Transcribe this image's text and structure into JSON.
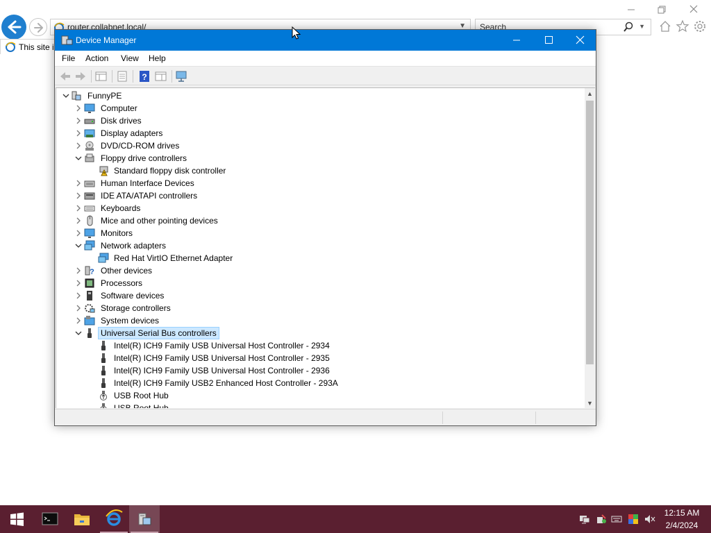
{
  "browser": {
    "address_url": "router.collabnet.local/",
    "search_placeholder": "Search",
    "tab_title": "This site is"
  },
  "device_manager": {
    "title": "Device Manager",
    "menu": [
      "File",
      "Action",
      "View",
      "Help"
    ],
    "tree": [
      {
        "label": "FunnyPE",
        "level": 0,
        "expander": "expanded",
        "icon": "computer-root-icon"
      },
      {
        "label": "Computer",
        "level": 1,
        "expander": "collapsed",
        "icon": "monitor-icon"
      },
      {
        "label": "Disk drives",
        "level": 1,
        "expander": "collapsed",
        "icon": "disk-drive-icon"
      },
      {
        "label": "Display adapters",
        "level": 1,
        "expander": "collapsed",
        "icon": "display-adapter-icon"
      },
      {
        "label": "DVD/CD-ROM drives",
        "level": 1,
        "expander": "collapsed",
        "icon": "dvd-drive-icon"
      },
      {
        "label": "Floppy drive controllers",
        "level": 1,
        "expander": "expanded",
        "icon": "floppy-controller-icon"
      },
      {
        "label": "Standard floppy disk controller",
        "level": 2,
        "expander": "none",
        "icon": "warning-device-icon"
      },
      {
        "label": "Human Interface Devices",
        "level": 1,
        "expander": "collapsed",
        "icon": "hid-icon"
      },
      {
        "label": "IDE ATA/ATAPI controllers",
        "level": 1,
        "expander": "collapsed",
        "icon": "ide-controller-icon"
      },
      {
        "label": "Keyboards",
        "level": 1,
        "expander": "collapsed",
        "icon": "keyboard-icon"
      },
      {
        "label": "Mice and other pointing devices",
        "level": 1,
        "expander": "collapsed",
        "icon": "mouse-icon"
      },
      {
        "label": "Monitors",
        "level": 1,
        "expander": "collapsed",
        "icon": "monitor-icon"
      },
      {
        "label": "Network adapters",
        "level": 1,
        "expander": "expanded",
        "icon": "network-adapter-icon"
      },
      {
        "label": "Red Hat VirtIO Ethernet Adapter",
        "level": 2,
        "expander": "none",
        "icon": "network-adapter-icon"
      },
      {
        "label": "Other devices",
        "level": 1,
        "expander": "collapsed",
        "icon": "other-devices-icon"
      },
      {
        "label": "Processors",
        "level": 1,
        "expander": "collapsed",
        "icon": "processor-icon"
      },
      {
        "label": "Software devices",
        "level": 1,
        "expander": "collapsed",
        "icon": "software-device-icon"
      },
      {
        "label": "Storage controllers",
        "level": 1,
        "expander": "collapsed",
        "icon": "storage-controller-icon"
      },
      {
        "label": "System devices",
        "level": 1,
        "expander": "collapsed",
        "icon": "system-device-icon"
      },
      {
        "label": "Universal Serial Bus controllers",
        "level": 1,
        "expander": "expanded",
        "icon": "usb-icon",
        "selected": true
      },
      {
        "label": "Intel(R) ICH9 Family USB Universal Host Controller - 2934",
        "level": 2,
        "expander": "none",
        "icon": "usb-icon"
      },
      {
        "label": "Intel(R) ICH9 Family USB Universal Host Controller - 2935",
        "level": 2,
        "expander": "none",
        "icon": "usb-icon"
      },
      {
        "label": "Intel(R) ICH9 Family USB Universal Host Controller - 2936",
        "level": 2,
        "expander": "none",
        "icon": "usb-icon"
      },
      {
        "label": "Intel(R) ICH9 Family USB2 Enhanced Host Controller - 293A",
        "level": 2,
        "expander": "none",
        "icon": "usb-icon"
      },
      {
        "label": "USB Root Hub",
        "level": 2,
        "expander": "none",
        "icon": "usb-hub-icon"
      },
      {
        "label": "USB Root Hub",
        "level": 2,
        "expander": "none",
        "icon": "usb-hub-icon"
      }
    ]
  },
  "taskbar": {
    "time": "12:15 AM",
    "date": "2/4/2024",
    "accent_color": "#5a1f30"
  },
  "colors": {
    "titlebar": "#0078d7",
    "selection": "#cce8ff"
  }
}
